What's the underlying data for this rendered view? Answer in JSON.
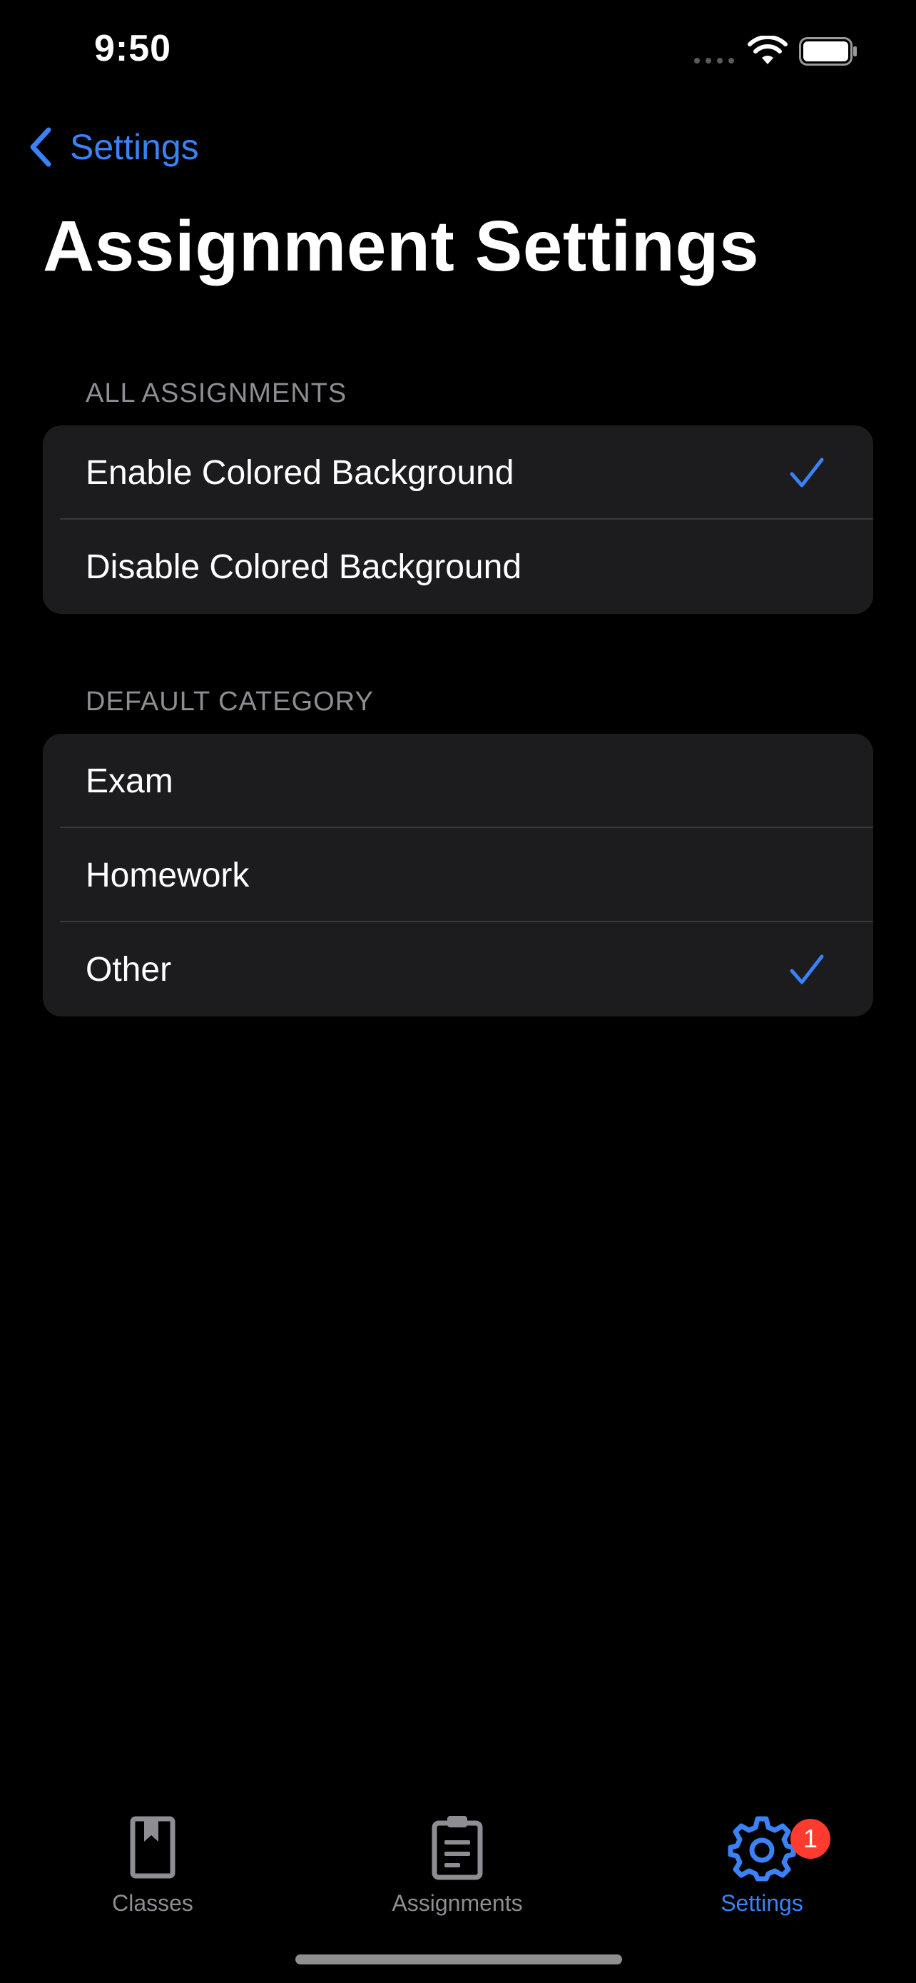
{
  "status_bar": {
    "time": "9:50"
  },
  "nav": {
    "back_label": "Settings",
    "title": "Assignment Settings"
  },
  "sections": [
    {
      "header": "ALL ASSIGNMENTS",
      "rows": [
        {
          "label": "Enable Colored Background",
          "checked": true
        },
        {
          "label": "Disable Colored Background",
          "checked": false
        }
      ]
    },
    {
      "header": "DEFAULT CATEGORY",
      "rows": [
        {
          "label": "Exam",
          "checked": false
        },
        {
          "label": "Homework",
          "checked": false
        },
        {
          "label": "Other",
          "checked": true
        }
      ]
    }
  ],
  "tab_bar": {
    "tabs": [
      {
        "label": "Classes",
        "icon": "book-icon",
        "active": false
      },
      {
        "label": "Assignments",
        "icon": "clipboard-icon",
        "active": false
      },
      {
        "label": "Settings",
        "icon": "gear-icon",
        "active": true,
        "badge": "1"
      }
    ]
  },
  "colors": {
    "accent": "#3a82f6",
    "background": "#000000",
    "group_background": "#1c1c1e",
    "badge": "#ff3b30",
    "secondary_text": "#8d8d93"
  }
}
